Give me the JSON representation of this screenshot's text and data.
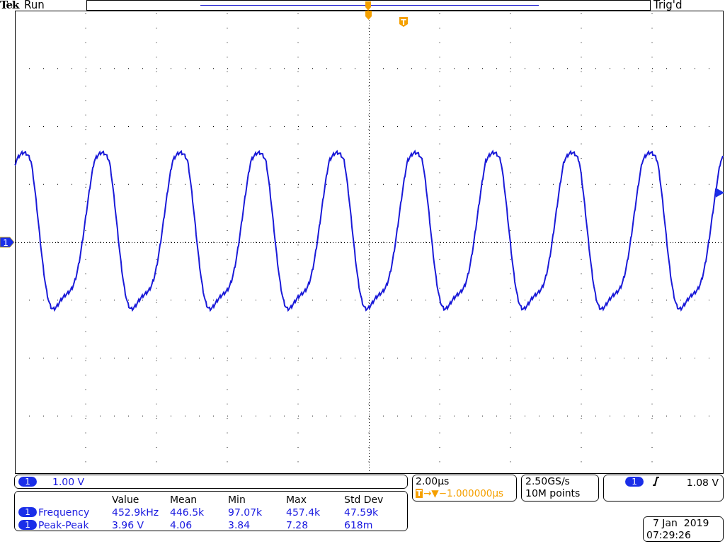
{
  "header": {
    "brand": "Tek",
    "run_state": "Run",
    "trigger_status": "Trig'd"
  },
  "trigger_marker": "T",
  "channel_marker": "1",
  "channel_scale": {
    "channel": "1",
    "scale": "1.00 V"
  },
  "measurements": {
    "columns": [
      "Value",
      "Mean",
      "Min",
      "Max",
      "Std Dev"
    ],
    "rows": [
      {
        "channel": "1",
        "name": "Frequency",
        "values": [
          "452.9kHz",
          "446.5k",
          "97.07k",
          "457.4k",
          "47.59k"
        ]
      },
      {
        "channel": "1",
        "name": "Peak-Peak",
        "values": [
          "3.96 V",
          "4.06",
          "3.84",
          "7.28",
          "618m"
        ]
      }
    ]
  },
  "timebase": {
    "scale": "2.00µs",
    "trigger_badge": "T",
    "position": "→▼−1.000000µs"
  },
  "acquisition": {
    "sample_rate": "2.50GS/s",
    "record_length": "10M points"
  },
  "trigger": {
    "source": "1",
    "level": "1.08 V"
  },
  "datetime": {
    "date": "7 Jan  2019",
    "time": "07:29:26"
  }
}
